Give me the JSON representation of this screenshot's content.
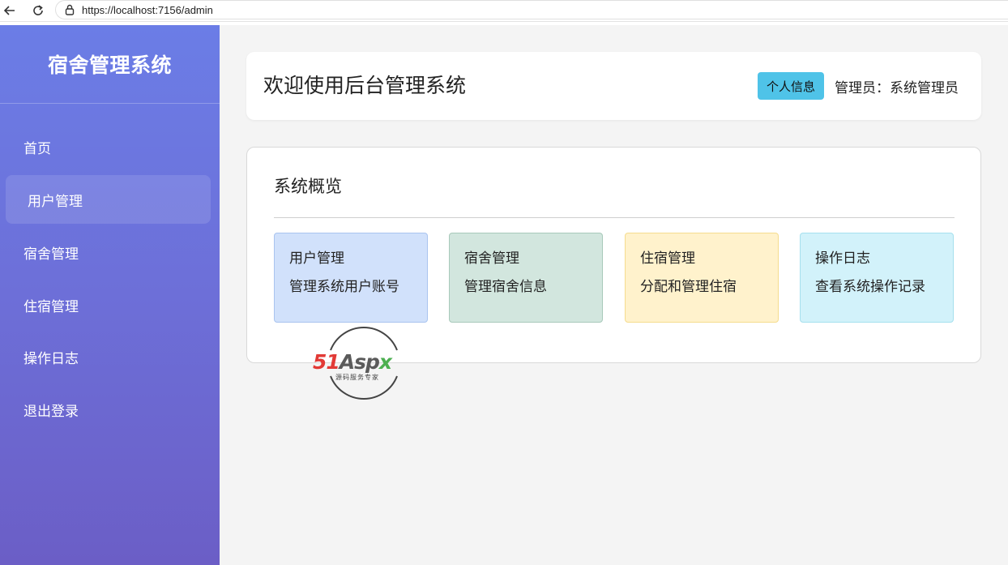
{
  "browser": {
    "url": "https://localhost:7156/admin"
  },
  "sidebar": {
    "brand": "宿舍管理系统",
    "items": [
      {
        "label": "首页"
      },
      {
        "label": "用户管理",
        "active": true
      },
      {
        "label": "宿舍管理"
      },
      {
        "label": "住宿管理"
      },
      {
        "label": "操作日志"
      },
      {
        "label": "退出登录"
      }
    ]
  },
  "header": {
    "title": "欢迎使用后台管理系统",
    "profile_button": "个人信息",
    "admin_label": "管理员：系统管理员"
  },
  "overview": {
    "title": "系统概览",
    "tiles": [
      {
        "title": "用户管理",
        "desc": "管理系统用户账号",
        "color": "#d1e1fb"
      },
      {
        "title": "宿舍管理",
        "desc": "管理宿舍信息",
        "color": "#d2e6de"
      },
      {
        "title": "住宿管理",
        "desc": "分配和管理住宿",
        "color": "#fff2cc"
      },
      {
        "title": "操作日志",
        "desc": "查看系统操作记录",
        "color": "#d2f2fa"
      }
    ]
  },
  "watermark": {
    "brand_51": "51",
    "brand_asp": "Asp",
    "brand_x": "x",
    "tagline": "源码服务专家"
  },
  "colors": {
    "sidebar_top": "#6b7de6",
    "sidebar_bottom": "#6b5ec6",
    "accent_button": "#4fc3e8",
    "main_bg": "#f4f4f4"
  }
}
